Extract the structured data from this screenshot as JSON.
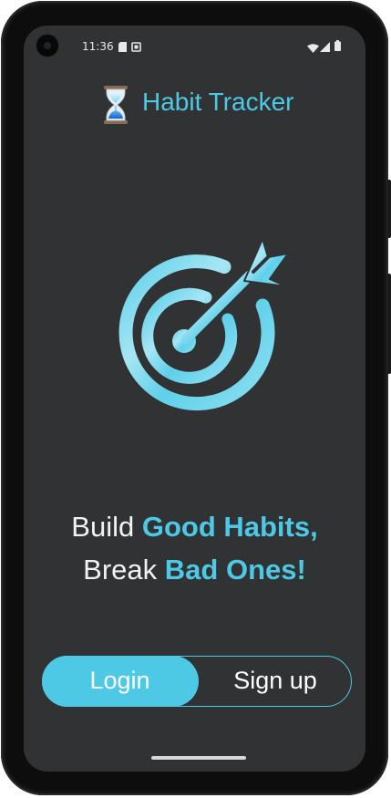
{
  "status_bar": {
    "time": "11:36",
    "left_icons": [
      "sim-card-icon",
      "screenshot-icon"
    ],
    "right_icons": [
      "wifi-icon",
      "cellular-signal-icon",
      "battery-icon"
    ]
  },
  "app": {
    "title": "Habit Tracker",
    "logo_icon": "hourglass-icon"
  },
  "hero": {
    "icon": "target-arrow-icon"
  },
  "tagline": {
    "line1_plain": "Build ",
    "line1_accent": "Good Habits,",
    "line2_plain": "Break ",
    "line2_accent": "Bad Ones!"
  },
  "auth": {
    "login_label": "Login",
    "signup_label": "Sign up",
    "selected": "Login"
  },
  "colors": {
    "accent": "#4dc9e6",
    "background": "#303234",
    "text": "#f2f2f2"
  }
}
